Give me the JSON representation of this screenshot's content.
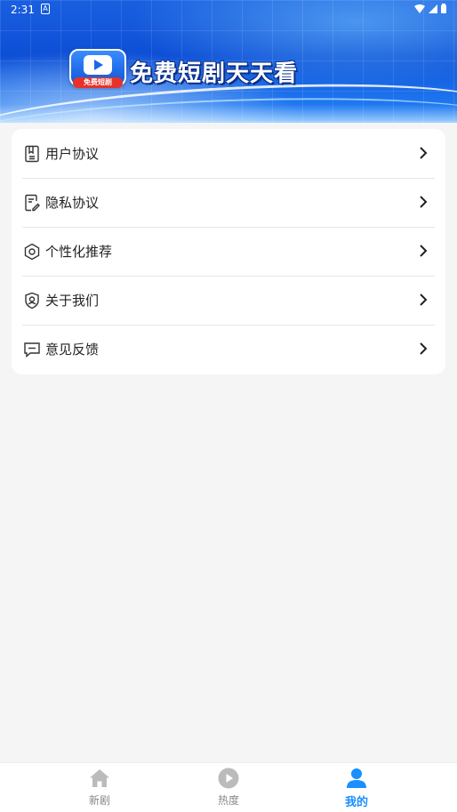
{
  "status_bar": {
    "time": "2:31",
    "notification_glyph": "A"
  },
  "header": {
    "app_title": "免费短剧天天看",
    "logo_badge": "免费短剧",
    "accent_color": "#0d4fd6"
  },
  "menu": {
    "items": [
      {
        "label": "用户协议",
        "icon": "document-icon"
      },
      {
        "label": "隐私协议",
        "icon": "privacy-edit-icon"
      },
      {
        "label": "个性化推荐",
        "icon": "gear-icon"
      },
      {
        "label": "关于我们",
        "icon": "shield-user-icon"
      },
      {
        "label": "意见反馈",
        "icon": "message-icon"
      }
    ]
  },
  "tabbar": {
    "tabs": [
      {
        "label": "新剧",
        "icon": "home-icon",
        "active": false
      },
      {
        "label": "热度",
        "icon": "play-circle-icon",
        "active": false
      },
      {
        "label": "我的",
        "icon": "user-icon",
        "active": true
      }
    ],
    "active_color": "#1a8fff",
    "inactive_color": "#bbbbbb"
  }
}
